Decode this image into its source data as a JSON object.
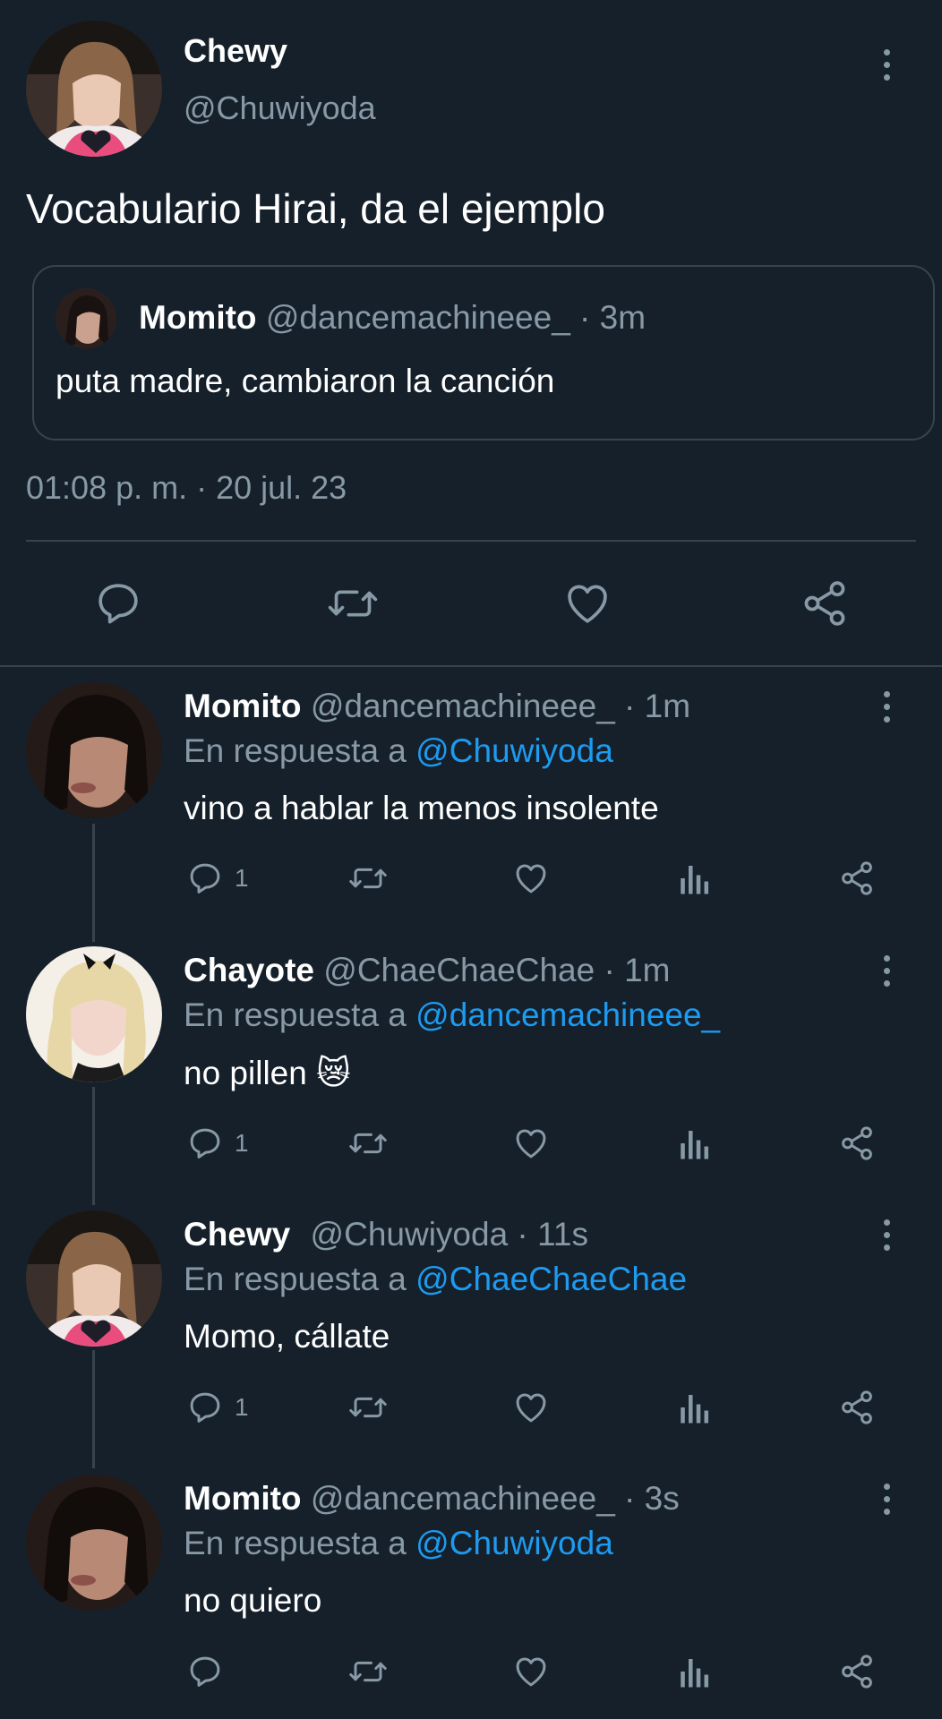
{
  "main_tweet": {
    "name": "Chewy",
    "handle": "@Chuwiyoda",
    "text": "Vocabulario Hirai, da el ejemplo",
    "quote": {
      "name": "Momito",
      "handle_time": "@dancemachineee_ · 3m",
      "text": "puta madre, cambiaron la canción"
    },
    "timestamp": "01:08 p. m. · 20 jul. 23"
  },
  "replies": [
    {
      "name": "Momito",
      "handle_time": "@dancemachineee_ · 1m",
      "reply_prefix": "En respuesta a",
      "reply_to": "@Chuwiyoda",
      "text": "vino a hablar la menos insolente",
      "reply_count": "1"
    },
    {
      "name": "Chayote",
      "handle_time": "@ChaeChaeChae · 1m",
      "reply_prefix": "En respuesta a",
      "reply_to": "@dancemachineee_",
      "text": "no pillen",
      "emoji": "😿",
      "reply_count": "1"
    },
    {
      "name": "Chewy",
      "handle_time": "@Chuwiyoda · 11s",
      "reply_prefix": "En respuesta a",
      "reply_to": "@ChaeChaeChae",
      "text": "Momo, cállate",
      "reply_count": "1"
    },
    {
      "name": "Momito",
      "handle_time": "@dancemachineee_ · 3s",
      "reply_prefix": "En respuesta a",
      "reply_to": "@Chuwiyoda",
      "text": "no quiero",
      "reply_count": ""
    }
  ],
  "icons": {
    "reply": "reply-icon",
    "retweet": "retweet-icon",
    "like": "like-icon",
    "share": "share-icon",
    "views": "views-icon",
    "more": "more-options-icon"
  },
  "colors": {
    "background": "#15202b",
    "muted": "#8899a6",
    "link": "#1d9bf0",
    "divider": "#38444d"
  }
}
